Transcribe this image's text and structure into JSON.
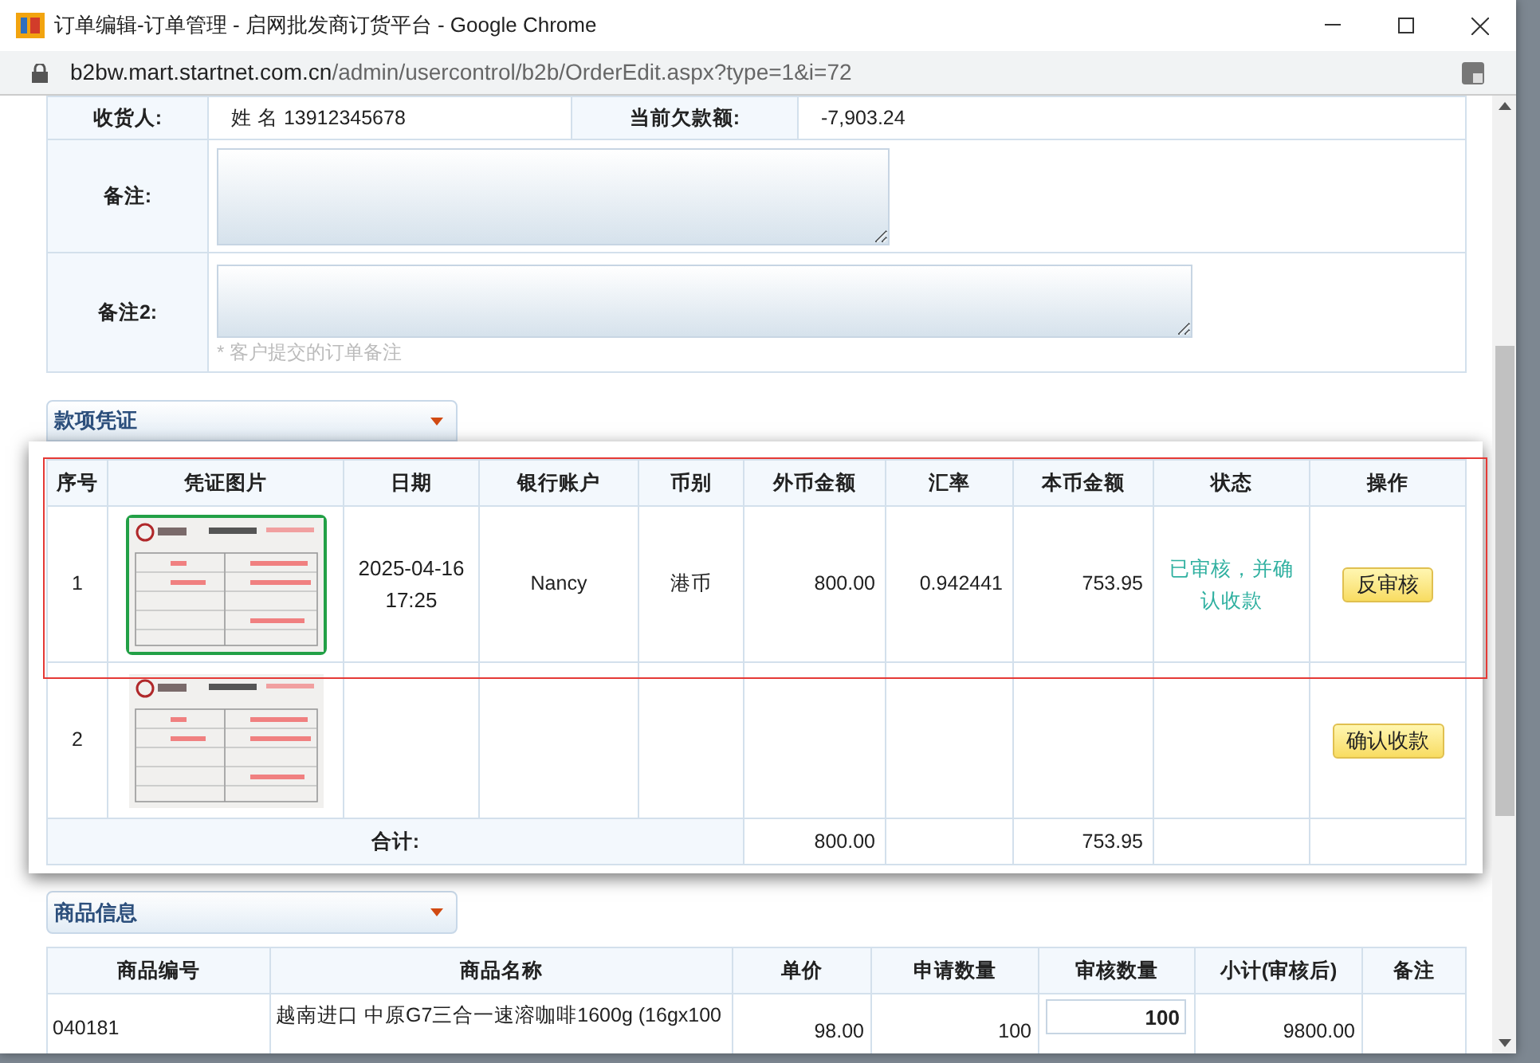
{
  "window": {
    "title": "订单编辑-订单管理 - 启网批发商订货平台 - Google Chrome",
    "url_host": "b2bw.mart.startnet.com.cn",
    "url_path": "/admin/usercontrol/b2b/OrderEdit.aspx?type=1&i=72"
  },
  "order_info": {
    "consignee_label": "收货人:",
    "consignee_value": "姓 名 13912345678",
    "debt_label": "当前欠款额:",
    "debt_value": "-7,903.24",
    "remark_label": "备注:",
    "remark2_label": "备注2:",
    "remark2_hint": "* 客户提交的订单备注"
  },
  "payment_section": {
    "title": "款项凭证",
    "columns": [
      "序号",
      "凭证图片",
      "日期",
      "银行账户",
      "币别",
      "外币金额",
      "汇率",
      "本币金额",
      "状态",
      "操作"
    ],
    "rows": [
      {
        "no": "1",
        "image_selected": true,
        "highlighted": true,
        "date": "2025-04-16 17:25",
        "account": "Nancy",
        "currency": "港币",
        "foreign_amount": "800.00",
        "rate": "0.942441",
        "local_amount": "753.95",
        "status": "已审核，并确认收款",
        "action": "反审核"
      },
      {
        "no": "2",
        "image_selected": false,
        "highlighted": false,
        "action": "确认收款"
      }
    ],
    "totals": {
      "label": "合计:",
      "foreign_amount": "800.00",
      "local_amount": "753.95"
    }
  },
  "product_section": {
    "title": "商品信息",
    "columns": [
      "商品编号",
      "商品名称",
      "单价",
      "申请数量",
      "审核数量",
      "小计(审核后)",
      "备注"
    ],
    "rows": [
      {
        "code": "040181",
        "name": "越南进口 中原G7三合一速溶咖啡1600g (16gx100",
        "price": "98.00",
        "requested": "100",
        "approved": "100",
        "subtotal": "9800.00"
      }
    ]
  }
}
